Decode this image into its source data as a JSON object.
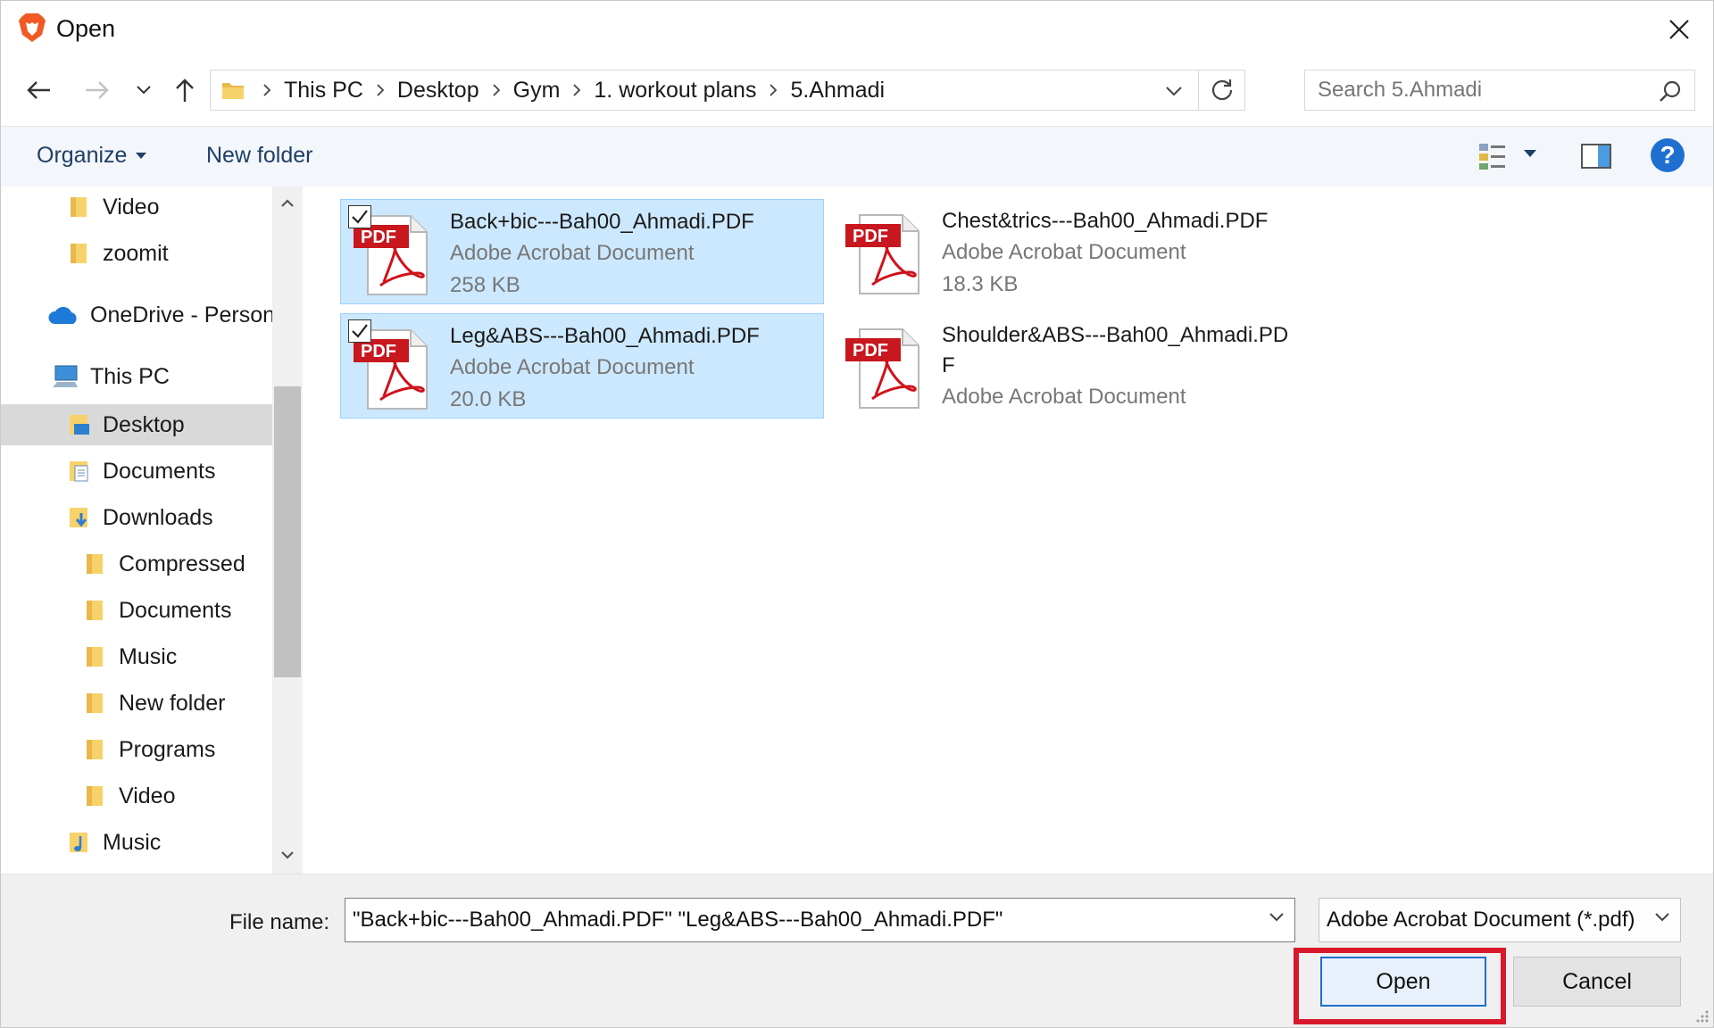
{
  "window": {
    "title": "Open",
    "accent": "#1f6fd1",
    "highlight": "#d9182b"
  },
  "breadcrumb": [
    "This PC",
    "Desktop",
    "Gym",
    "1. workout plans",
    "5.Ahmadi"
  ],
  "search": {
    "placeholder": "Search 5.Ahmadi"
  },
  "toolbar": {
    "organize": "Organize",
    "new_folder": "New folder",
    "help": "?"
  },
  "sidebar": {
    "items": [
      {
        "label": "Video",
        "icon": "folder-icon"
      },
      {
        "label": "zoomit",
        "icon": "folder-icon"
      },
      {
        "label": "OneDrive - Person",
        "icon": "cloud-icon"
      },
      {
        "label": "This PC",
        "icon": "computer-icon"
      },
      {
        "label": "Desktop",
        "icon": "desktop-icon",
        "selected": true
      },
      {
        "label": "Documents",
        "icon": "documents-icon"
      },
      {
        "label": "Downloads",
        "icon": "downloads-icon"
      },
      {
        "label": "Compressed",
        "icon": "folder-icon"
      },
      {
        "label": "Documents",
        "icon": "folder-icon"
      },
      {
        "label": "Music",
        "icon": "folder-icon"
      },
      {
        "label": "New folder",
        "icon": "folder-icon"
      },
      {
        "label": "Programs",
        "icon": "folder-icon"
      },
      {
        "label": "Video",
        "icon": "folder-icon"
      },
      {
        "label": "Music",
        "icon": "music-icon"
      }
    ]
  },
  "files": [
    {
      "name": "Back+bic---Bah00_Ahmadi.PDF",
      "type": "Adobe Acrobat Document",
      "size": "258 KB",
      "selected": true
    },
    {
      "name": "Chest&trics---Bah00_Ahmadi.PDF",
      "type": "Adobe Acrobat Document",
      "size": "18.3 KB",
      "selected": false
    },
    {
      "name": "Leg&ABS---Bah00_Ahmadi.PDF",
      "type": "Adobe Acrobat Document",
      "size": "20.0 KB",
      "selected": true
    },
    {
      "name": "Shoulder&ABS---Bah00_Ahmadi.PDF",
      "type": "Adobe Acrobat Document",
      "size": "",
      "selected": false
    }
  ],
  "pdf_badge": "PDF",
  "bottom": {
    "file_name_label": "File name:",
    "file_name_value": "\"Back+bic---Bah00_Ahmadi.PDF\" \"Leg&ABS---Bah00_Ahmadi.PDF\"",
    "file_type": "Adobe Acrobat Document (*.pdf)",
    "open": "Open",
    "cancel": "Cancel"
  }
}
